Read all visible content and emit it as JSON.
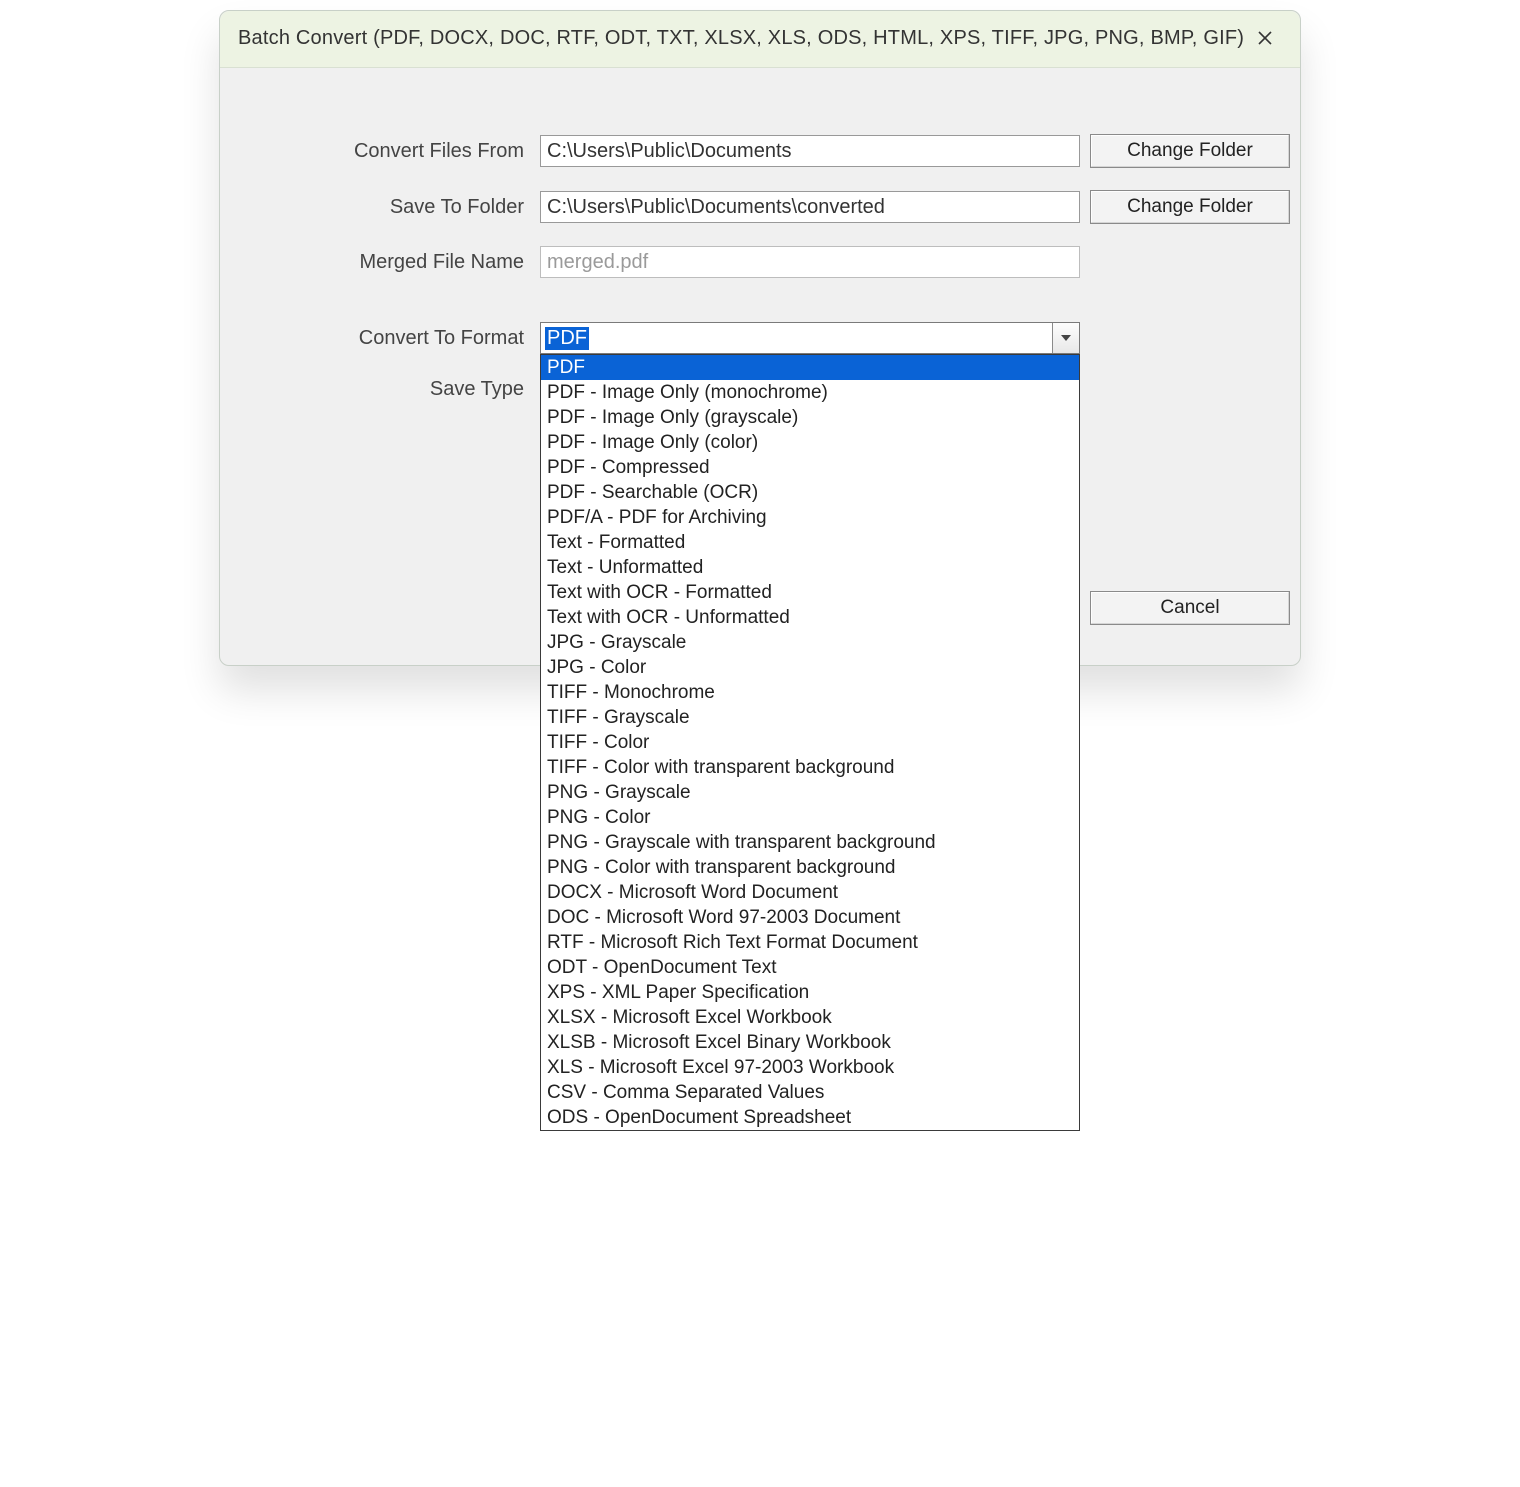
{
  "window": {
    "title": "Batch Convert (PDF, DOCX, DOC, RTF, ODT, TXT, XLSX, XLS, ODS, HTML, XPS, TIFF, JPG, PNG, BMP, GIF)"
  },
  "labels": {
    "convert_from": "Convert Files From",
    "save_to": "Save To Folder",
    "merged_name": "Merged File Name",
    "convert_to_format": "Convert To Format",
    "save_type": "Save Type"
  },
  "fields": {
    "convert_from": "C:\\Users\\Public\\Documents",
    "save_to": "C:\\Users\\Public\\Documents\\converted",
    "merged_name": "merged.pdf",
    "format_selected": "PDF"
  },
  "buttons": {
    "change_folder": "Change Folder",
    "cancel": "Cancel"
  },
  "format_options": [
    "PDF",
    "PDF - Image Only (monochrome)",
    "PDF - Image Only (grayscale)",
    "PDF - Image Only (color)",
    "PDF - Compressed",
    "PDF - Searchable (OCR)",
    "PDF/A - PDF for Archiving",
    "Text - Formatted",
    "Text - Unformatted",
    "Text with OCR - Formatted",
    "Text with OCR - Unformatted",
    "JPG - Grayscale",
    "JPG - Color",
    "TIFF - Monochrome",
    "TIFF - Grayscale",
    "TIFF - Color",
    "TIFF - Color with transparent background",
    "PNG - Grayscale",
    "PNG - Color",
    "PNG - Grayscale with transparent background",
    "PNG - Color with transparent background",
    "DOCX - Microsoft Word Document",
    "DOC - Microsoft Word 97-2003 Document",
    "RTF - Microsoft Rich Text Format Document",
    "ODT - OpenDocument Text",
    "XPS - XML Paper Specification",
    "XLSX - Microsoft Excel Workbook",
    "XLSB - Microsoft Excel Binary Workbook",
    "XLS - Microsoft Excel 97-2003 Workbook",
    "CSV - Comma Separated Values",
    "ODS - OpenDocument Spreadsheet"
  ]
}
